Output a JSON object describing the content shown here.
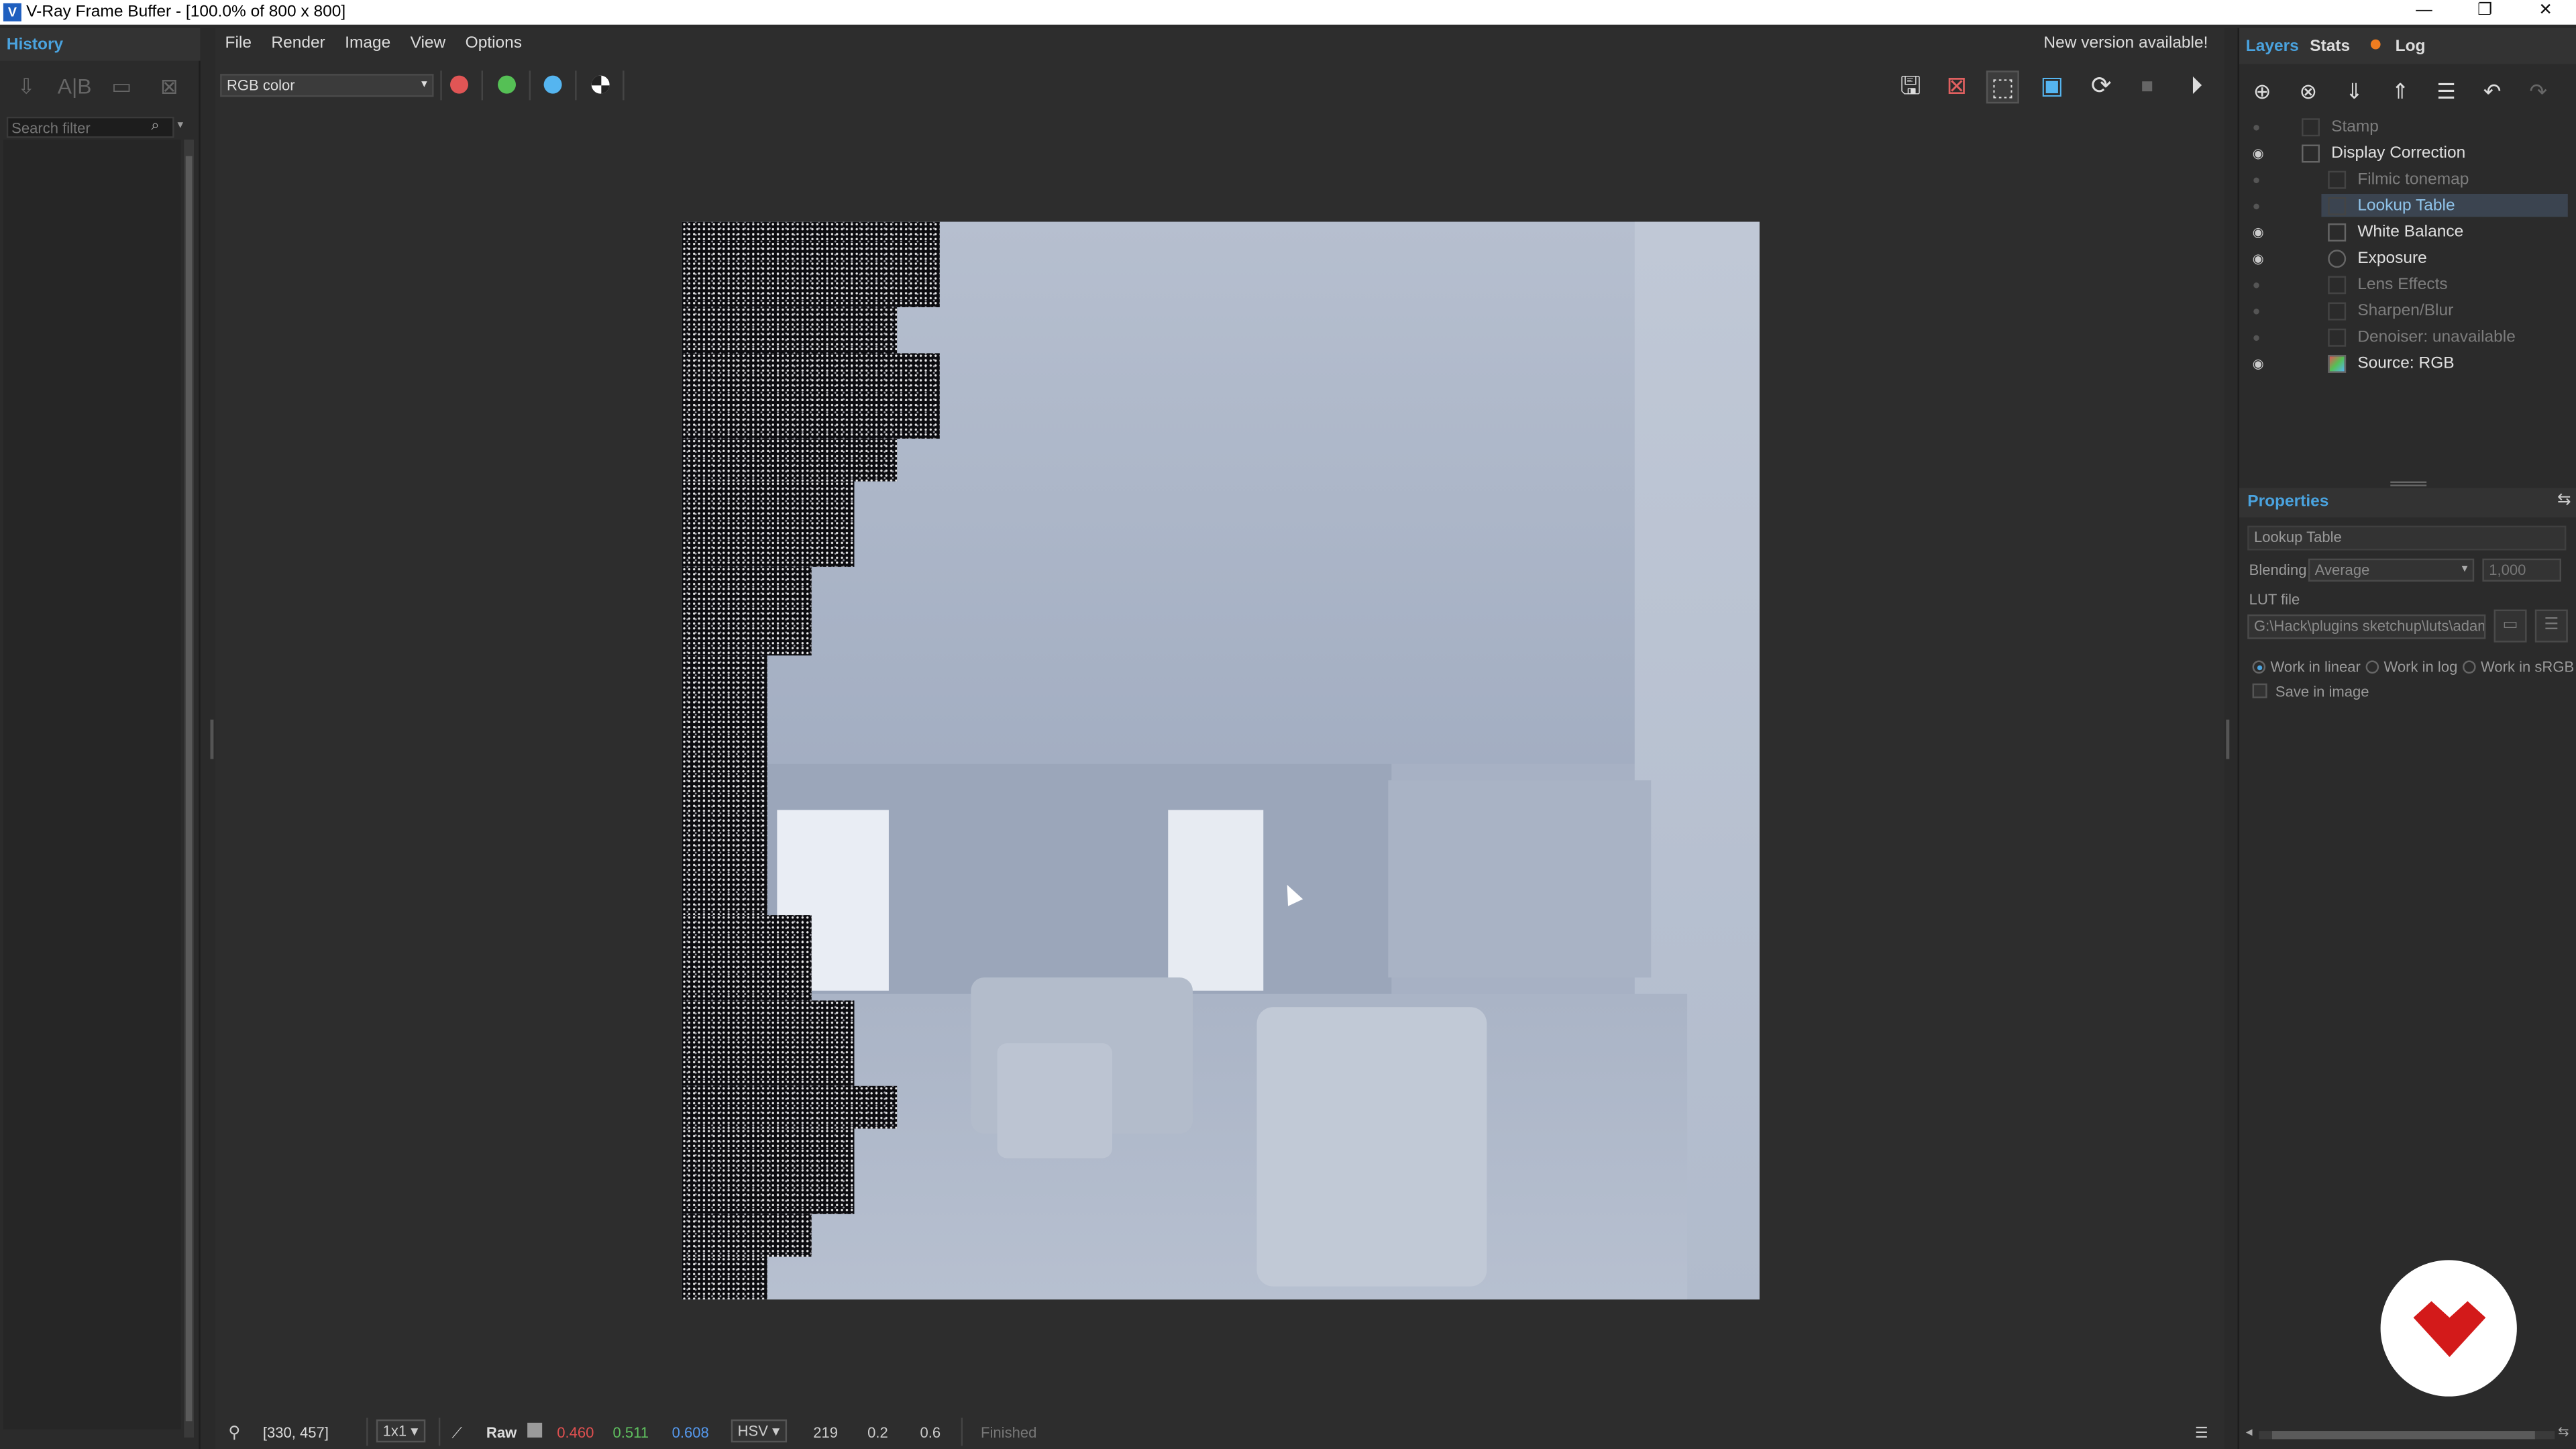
{
  "window": {
    "title": "V-Ray Frame Buffer - [100.0% of 800 x 800]",
    "app_icon": "V",
    "controls": {
      "minimize": "—",
      "restore": "❐",
      "close": "✕"
    }
  },
  "history": {
    "tab_label": "History",
    "search_placeholder": "Search filter",
    "search_icon": "⌕",
    "dropdown_icon": "▾"
  },
  "menu": [
    "File",
    "Render",
    "Image",
    "View",
    "Options"
  ],
  "banner": "New version available!",
  "channel": {
    "selected": "RGB color",
    "dd": "▾"
  },
  "colors": {
    "red": "#e05555",
    "green": "#55c055",
    "blue": "#55b5f0",
    "accent": "#4aa3df",
    "log_dot": "#f07d20"
  },
  "status": {
    "coords": "[330, 457]",
    "zoom_ratio": "1x1",
    "raw_label": "Raw",
    "r": "0.460",
    "g": "0.511",
    "b": "0.608",
    "color_mode": "HSV",
    "h": "219",
    "s": "0.2",
    "v": "0.6",
    "state": "Finished"
  },
  "right_tabs": {
    "layers": "Layers",
    "stats": "Stats",
    "log": "Log"
  },
  "layers": [
    {
      "name": "Stamp",
      "visible": false
    },
    {
      "name": "Display Correction",
      "visible": true
    },
    {
      "name": "Filmic tonemap",
      "visible": false
    },
    {
      "name": "Lookup Table",
      "visible": false,
      "selected": true
    },
    {
      "name": "White Balance",
      "visible": true
    },
    {
      "name": "Exposure",
      "visible": true
    },
    {
      "name": "Lens Effects",
      "visible": false
    },
    {
      "name": "Sharpen/Blur",
      "visible": false
    },
    {
      "name": "Denoiser: unavailable",
      "visible": false
    },
    {
      "name": "Source: RGB",
      "visible": true
    }
  ],
  "properties": {
    "heading": "Properties",
    "layer_name": "Lookup Table",
    "blending_label": "Blending",
    "blending_value": "Average",
    "blending_amount": "1,000",
    "lut_label": "LUT file",
    "lut_path": "G:\\Hack\\plugins sketchup\\luts\\adam",
    "work_linear": "Work in linear",
    "work_log": "Work in log",
    "work_srgb": "Work in sRGB",
    "save_in_image": "Save in image"
  }
}
